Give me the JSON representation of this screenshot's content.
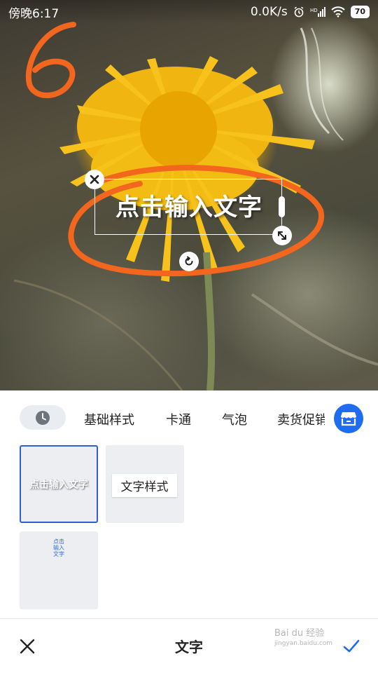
{
  "status_bar": {
    "time": "傍晚6:17",
    "network_speed": "0.0K/s",
    "network_type": "HD",
    "battery": "70"
  },
  "editor": {
    "sticker_text": "点击输入文字",
    "annotation_number": "6"
  },
  "style_tabs": {
    "history_icon": "clock-icon",
    "items": [
      "基础样式",
      "卡通",
      "气泡",
      "卖货促销"
    ],
    "store_icon": "store-icon"
  },
  "style_tiles": [
    {
      "text": "点击输入文字",
      "selected": true
    },
    {
      "text": "文字样式",
      "selected": false
    },
    {
      "text": "点击输入文字",
      "selected": false
    }
  ],
  "bottom_bar": {
    "close_icon": "close-icon",
    "title": "文字",
    "confirm_icon": "check-icon"
  },
  "watermark": {
    "line1": "Bai du 经验",
    "line2": "jingyan.baidu.com"
  },
  "colors": {
    "accent": "#1e6cf0",
    "selected_border": "#2f5fd0",
    "annotation": "#f2661e"
  }
}
